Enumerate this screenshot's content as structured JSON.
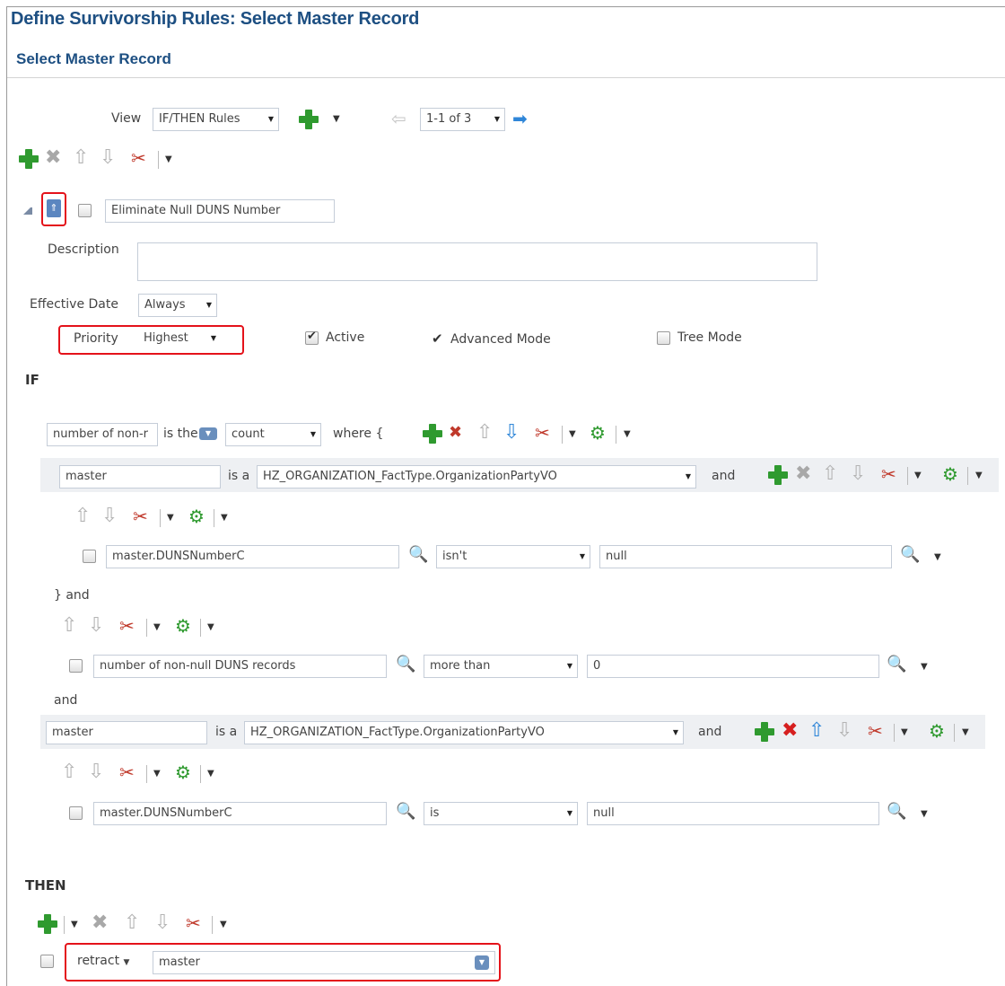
{
  "page_title": "Define Survivorship Rules: Select Master Record",
  "section_title": "Select Master Record",
  "toolbar": {
    "view_label": "View",
    "view_value": "IF/THEN Rules",
    "pager_value": "1-1 of 3"
  },
  "rule": {
    "name": "Eliminate Null DUNS Number",
    "description_label": "Description",
    "description_value": "",
    "effective_date_label": "Effective Date",
    "effective_date_value": "Always",
    "priority_label": "Priority",
    "priority_value": "Highest",
    "active_label": "Active",
    "active_checked": true,
    "advanced_label": "Advanced Mode",
    "tree_label": "Tree Mode",
    "tree_checked": false
  },
  "if_section": {
    "label": "IF",
    "aggregate": {
      "var": "number of non-r",
      "is_the": "is the",
      "func": "count",
      "where": "where {"
    },
    "pattern1": {
      "var": "master",
      "is_a": "is a",
      "type": "HZ_ORGANIZATION_FactType.OrganizationPartyVO",
      "and": "and",
      "test": {
        "field": "master.DUNSNumberC",
        "op": "isn't",
        "value": "null"
      }
    },
    "close_and": "} and",
    "test2": {
      "field": "number of non-null DUNS records",
      "op": "more than",
      "value": "0"
    },
    "and_label": "and",
    "pattern2": {
      "var": "master",
      "is_a": "is a",
      "type": "HZ_ORGANIZATION_FactType.OrganizationPartyVO",
      "and": "and",
      "test": {
        "field": "master.DUNSNumberC",
        "op": "is",
        "value": "null"
      }
    }
  },
  "then_section": {
    "label": "THEN",
    "action": "retract",
    "target": "master"
  },
  "colors": {
    "title": "#1d4f82",
    "highlight": "#e4121a",
    "add_green": "#2f9a2f",
    "band": "#eef0f3"
  }
}
